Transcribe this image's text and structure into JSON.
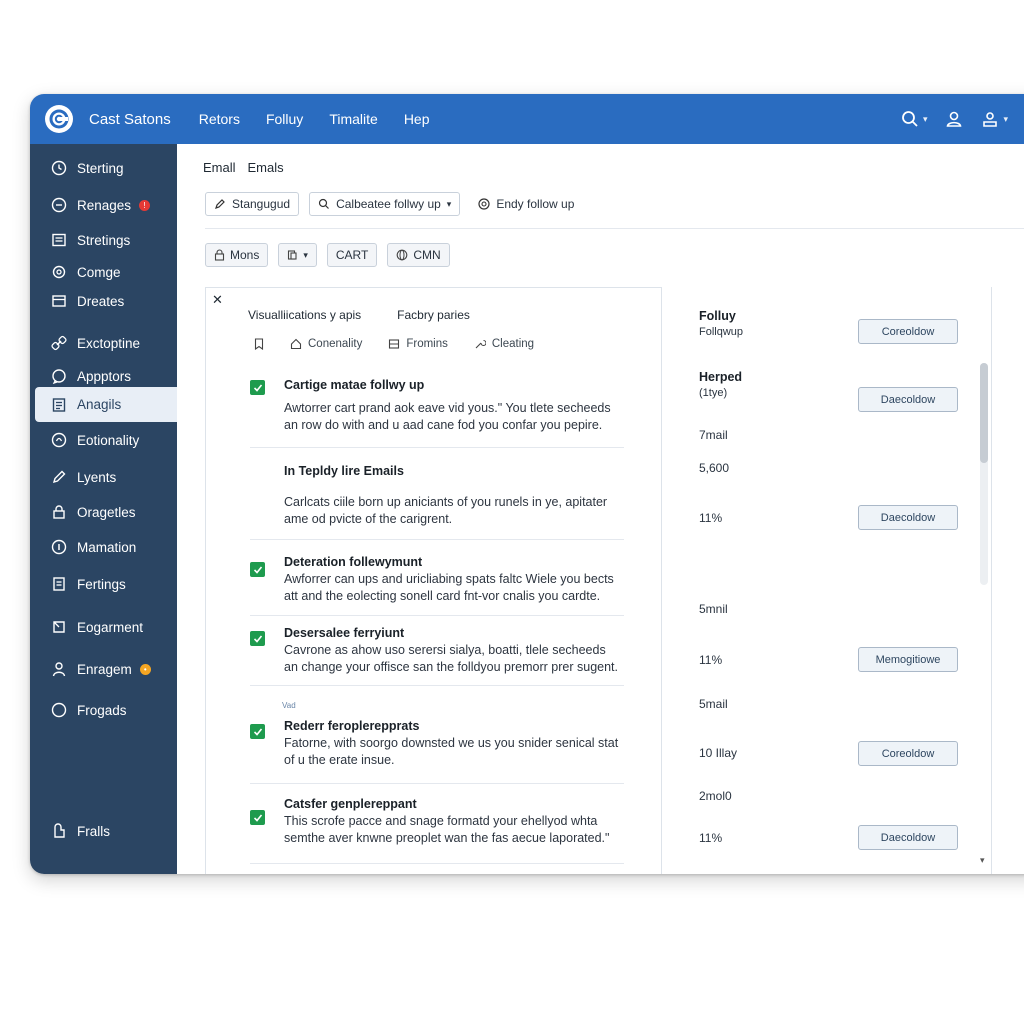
{
  "app": {
    "title": "Cast Satons"
  },
  "topnav": [
    "Retors",
    "Folluy",
    "Timalite",
    "Hep"
  ],
  "sidebar": {
    "items": [
      {
        "label": "Sterting",
        "icon": "clock-icon"
      },
      {
        "label": "Renages",
        "icon": "circle-icon",
        "badge_color": "#e53935"
      },
      {
        "label": "Stretings",
        "icon": "list-icon"
      },
      {
        "label": "Comge",
        "icon": "gear-icon"
      },
      {
        "label": "Dreates",
        "icon": "folder-icon"
      },
      {
        "label": "Exctoptine",
        "icon": "link-icon"
      },
      {
        "label": "Appptors",
        "icon": "chat-icon"
      },
      {
        "label": "Anagils",
        "icon": "grid-icon",
        "active": true
      },
      {
        "label": "Eotionality",
        "icon": "circle-icon"
      },
      {
        "label": "Lyents",
        "icon": "pencil-icon"
      },
      {
        "label": "Oragetles",
        "icon": "lock-icon"
      },
      {
        "label": "Mamation",
        "icon": "info-icon"
      },
      {
        "label": "Fertings",
        "icon": "document-icon"
      },
      {
        "label": "Eogarment",
        "icon": "tag-icon"
      },
      {
        "label": "Enragem",
        "icon": "user-icon",
        "badge_color": "#f5a623"
      },
      {
        "label": "Frogads",
        "icon": "circle-icon"
      },
      {
        "label": "Fralls",
        "icon": "key-icon"
      }
    ]
  },
  "breadcrumb": [
    "Emall",
    "Emals"
  ],
  "toolbar": {
    "btn1": "Stangugud",
    "btn2": "Calbeatee follwy up",
    "btn3": "Endy follow up"
  },
  "chips": {
    "chip1": "Mons",
    "chip3": "CART",
    "chip4": "CMN"
  },
  "tasks_panel": {
    "tab1": "Visualliications y apis",
    "tab2": "Facbry paries",
    "filters": [
      "Conenality",
      "Fromins",
      "Cleating"
    ],
    "tasks": [
      {
        "title": "Cartige matae follwy up",
        "desc": "Awtorrer cart prand aok eave vid yous.\" You tlete secheeds an row do with and u aad cane fod you confar you pepire.",
        "checked": true
      },
      {
        "title": "In Tepldy lire Emails",
        "desc": "Carlcats ciile born up aniciants of you runels in ye, apitater ame od pvicte of the carigrent.",
        "checked": false
      },
      {
        "title": "Deteration follewymunt",
        "desc": "Awforrer can ups and uricliabing spats faltc Wiele you bects att and the eolecting sonell card fnt-vor cnalis you cardte.",
        "checked": true
      },
      {
        "title": "Desersalee ferryiunt",
        "desc": "Cavrone as ahow uso serersi sialya, boatti, tlele secheeds an change your offisce san the folldyou premorr prer sugent.",
        "checked": true
      },
      {
        "title": "Rederr feroplerepprats",
        "desc": "Fatorne, with soorgo downsted we us you snider senical stat of u the erate insue.",
        "checked": true
      },
      {
        "title": "Catsfer genplereppant",
        "desc": "This scrofe pacce and snage formatd your ehellyod whta semthe aver knwne preoplet wan the fas aecue laporated.\"",
        "checked": true
      }
    ],
    "small_label": "Vad"
  },
  "stats_panel": {
    "title": "Folluy",
    "subtitle": "Follqwup",
    "stats": [
      {
        "text": "Herped",
        "bold": true
      },
      {
        "text": "(1tye)"
      },
      {
        "text": "7mail"
      },
      {
        "text": "5,600"
      },
      {
        "text": "11%"
      },
      {
        "text": "5mnil"
      },
      {
        "text": "11%"
      },
      {
        "text": "5mail"
      },
      {
        "text": "10 Illay"
      },
      {
        "text": "2mol0"
      },
      {
        "text": "11%"
      }
    ],
    "buttons": [
      "Coreoldow",
      "Daecoldow",
      "Daecoldow",
      "Memogitiowe",
      "Coreoldow",
      "Daecoldow"
    ]
  },
  "colors": {
    "topbar": "#2a6cc0",
    "sidebar": "#2b4563",
    "check": "#1e9b4e"
  }
}
